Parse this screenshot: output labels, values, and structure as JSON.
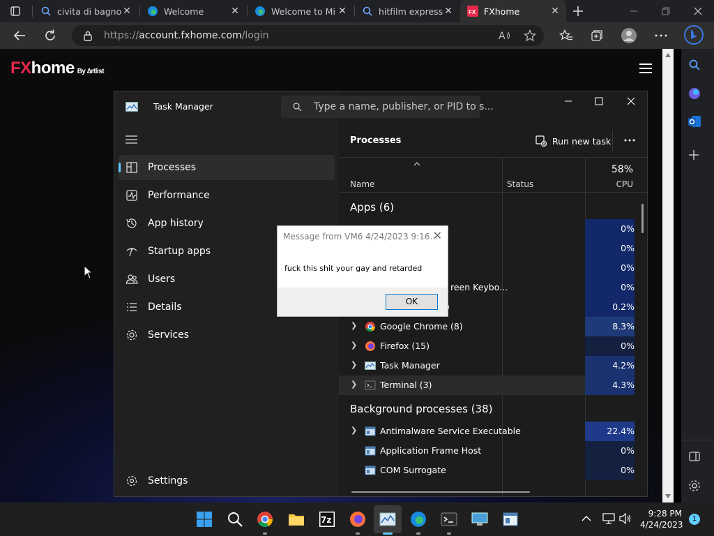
{
  "browser": {
    "tabs": [
      {
        "title": "civita di bagnoregio",
        "icon": "search-icon"
      },
      {
        "title": "Welcome",
        "icon": "edge-icon"
      },
      {
        "title": "Welcome to Microsoft",
        "icon": "edge-icon"
      },
      {
        "title": "hitfilm express -",
        "icon": "search-icon"
      },
      {
        "title": "FXhome",
        "icon": "fxhome-icon",
        "active": true
      }
    ],
    "url_prefix": "https://",
    "url_host": "account.fxhome.com",
    "url_path": "/login"
  },
  "page": {
    "logo_fx": "FX",
    "logo_home": "home",
    "logo_by": "By ∆rtlist"
  },
  "task_manager": {
    "title": "Task Manager",
    "search_placeholder": "Type a name, publisher, or PID to s...",
    "nav": [
      {
        "label": "Processes",
        "icon": "processes-icon",
        "selected": true
      },
      {
        "label": "Performance",
        "icon": "performance-icon"
      },
      {
        "label": "App history",
        "icon": "app-history-icon"
      },
      {
        "label": "Startup apps",
        "icon": "startup-apps-icon"
      },
      {
        "label": "Users",
        "icon": "users-icon"
      },
      {
        "label": "Details",
        "icon": "details-icon"
      },
      {
        "label": "Services",
        "icon": "services-icon"
      }
    ],
    "settings_label": "Settings",
    "header": "Processes",
    "run_new_task": "Run new task",
    "columns": {
      "name": "Name",
      "status": "Status",
      "cpu_total": "58%",
      "cpu": "CPU"
    },
    "apps_group": "Apps (6)",
    "hidden_rows": [
      {
        "name": "",
        "cpu": "0%"
      },
      {
        "name": "",
        "cpu": "0%"
      },
      {
        "name": "",
        "cpu": "0%"
      },
      {
        "name": "reen Keybo...",
        "cpu": "0%"
      },
      {
        "name": ")",
        "cpu": "0.2%"
      }
    ],
    "app_rows": [
      {
        "name": "Google Chrome (8)",
        "cpu": "8.3%",
        "icon": "chrome-icon"
      },
      {
        "name": "Firefox (15)",
        "cpu": "0%",
        "icon": "firefox-icon"
      },
      {
        "name": "Task Manager",
        "cpu": "4.2%",
        "icon": "task-manager-icon"
      },
      {
        "name": "Terminal (3)",
        "cpu": "4.3%",
        "icon": "terminal-icon"
      }
    ],
    "bg_group": "Background processes (38)",
    "bg_rows": [
      {
        "name": "Antimalware Service Executable",
        "cpu": "22.4%",
        "icon": "window-icon",
        "expandable": true
      },
      {
        "name": "Application Frame Host",
        "cpu": "0%",
        "icon": "window-icon"
      },
      {
        "name": "COM Surrogate",
        "cpu": "0%",
        "icon": "window-icon"
      }
    ]
  },
  "message_box": {
    "title": "Message from VM6 4/24/2023 9:16...",
    "body": "fuck this shit your gay and retarded",
    "ok": "OK"
  },
  "taskbar": {
    "time": "9:28 PM",
    "date": "4/24/2023",
    "notification_count": "1"
  },
  "colors": {
    "accent": "#60cdff",
    "fx_red": "#e8294c",
    "cpu_heat_high": "#1f3a78",
    "cpu_heat_low": "#13203f"
  }
}
